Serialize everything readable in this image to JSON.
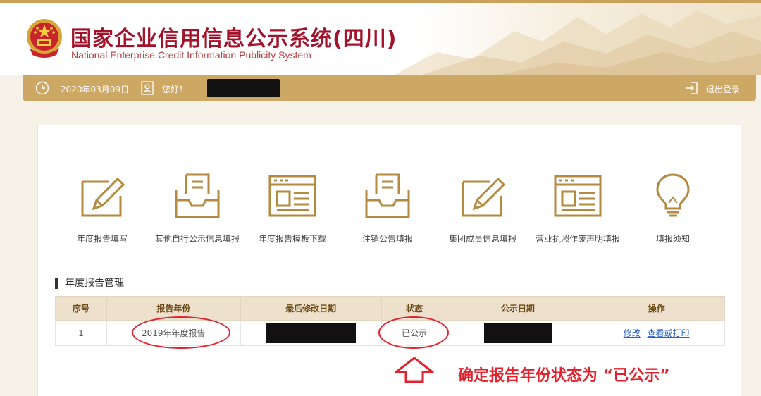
{
  "header": {
    "title": "国家企业信用信息公示系统(四川)",
    "subtitle": "National Enterprise Credit Information Publicity System"
  },
  "userbar": {
    "date": "2020年03月09日",
    "greeting": "您好！",
    "logout": "退出登录"
  },
  "functions": [
    {
      "label": "年度报告填写",
      "icon": "edit-icon"
    },
    {
      "label": "其他自行公示信息填报",
      "icon": "inbox-icon"
    },
    {
      "label": "年度报告模板下载",
      "icon": "template-icon"
    },
    {
      "label": "注销公告填报",
      "icon": "inbox-icon"
    },
    {
      "label": "集团成员信息填报",
      "icon": "edit-icon"
    },
    {
      "label": "营业执照作废声明填报",
      "icon": "template-icon"
    },
    {
      "label": "填报须知",
      "icon": "lightbulb-icon"
    }
  ],
  "section": {
    "title": "年度报告管理"
  },
  "table": {
    "headers": [
      "序号",
      "报告年份",
      "最后修改日期",
      "状态",
      "公示日期",
      "操作"
    ],
    "rows": [
      {
        "index": "1",
        "year": "2019年年度报告",
        "status": "已公示",
        "actions": [
          "修改",
          "查看或打印"
        ]
      }
    ]
  },
  "annotation": {
    "text": "确定报告年份状态为 “已公示”"
  },
  "colors": {
    "gold_bar": "#cda865",
    "title_red": "#a2132b",
    "annotation_red": "#e3222e",
    "icon_gold": "#b38a3f",
    "link_blue": "#2a62c9"
  }
}
